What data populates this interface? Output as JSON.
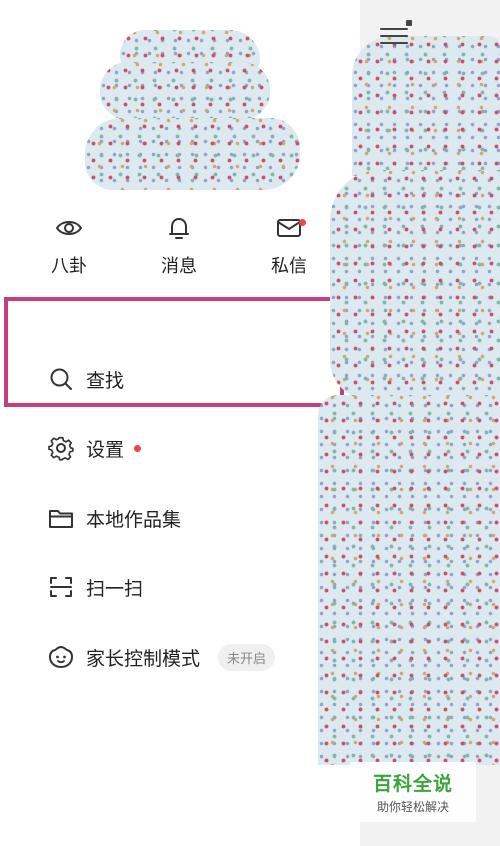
{
  "quick_actions": [
    {
      "label": "八卦",
      "icon": "eye-icon"
    },
    {
      "label": "消息",
      "icon": "bell-icon"
    },
    {
      "label": "私信",
      "icon": "mail-icon",
      "has_badge": true
    }
  ],
  "menu": {
    "search": {
      "label": "查找",
      "icon": "search-icon"
    },
    "settings": {
      "label": "设置",
      "icon": "gear-icon",
      "has_dot": true
    },
    "local_works": {
      "label": "本地作品集",
      "icon": "folder-icon"
    },
    "scan": {
      "label": "扫一扫",
      "icon": "scan-icon"
    },
    "parental": {
      "label": "家长控制模式",
      "icon": "child-face-icon",
      "status": "未开启"
    }
  },
  "watermark": {
    "title": "百科全说",
    "subtitle": "助你轻松解决"
  },
  "colors": {
    "highlight": "#c53f7f",
    "badge": "#e54a4a",
    "watermark_green": "#3aa53a"
  }
}
